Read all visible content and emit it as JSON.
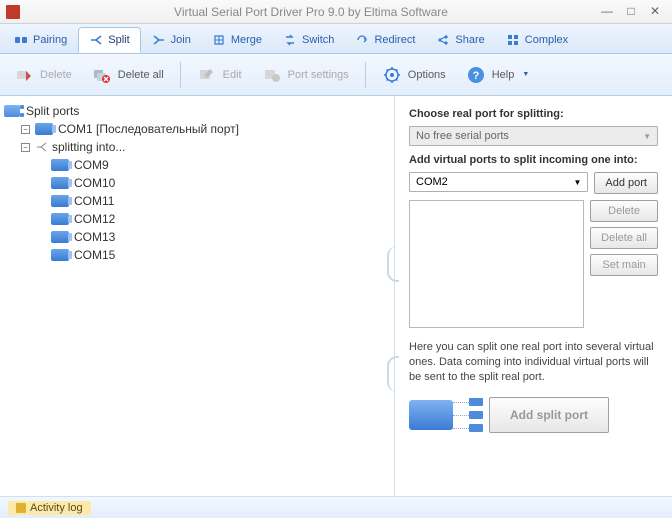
{
  "title": "Virtual Serial Port Driver Pro 9.0 by Eltima Software",
  "tabs": {
    "pairing": "Pairing",
    "split": "Split",
    "join": "Join",
    "merge": "Merge",
    "switch": "Switch",
    "redirect": "Redirect",
    "share": "Share",
    "complex": "Complex"
  },
  "toolbar": {
    "delete": "Delete",
    "delete_all": "Delete all",
    "edit": "Edit",
    "port_settings": "Port settings",
    "options": "Options",
    "help": "Help"
  },
  "tree": {
    "root": "Split ports",
    "com1": "COM1 [Последовательный порт]",
    "splitting": "splitting into...",
    "children": [
      "COM9",
      "COM10",
      "COM11",
      "COM12",
      "COM13",
      "COM15"
    ]
  },
  "right": {
    "choose_label": "Choose real port for splitting:",
    "no_ports": "No free serial ports",
    "add_virtual_label": "Add virtual ports to split incoming one into:",
    "combo_value": "COM2",
    "add_port": "Add port",
    "delete": "Delete",
    "delete_all": "Delete all",
    "set_main": "Set main",
    "hint": "Here you can split one real port into several virtual ones. Data coming into individual virtual ports will be sent to the split real port.",
    "add_split_port": "Add split port"
  },
  "status": {
    "activity": "Activity log"
  }
}
